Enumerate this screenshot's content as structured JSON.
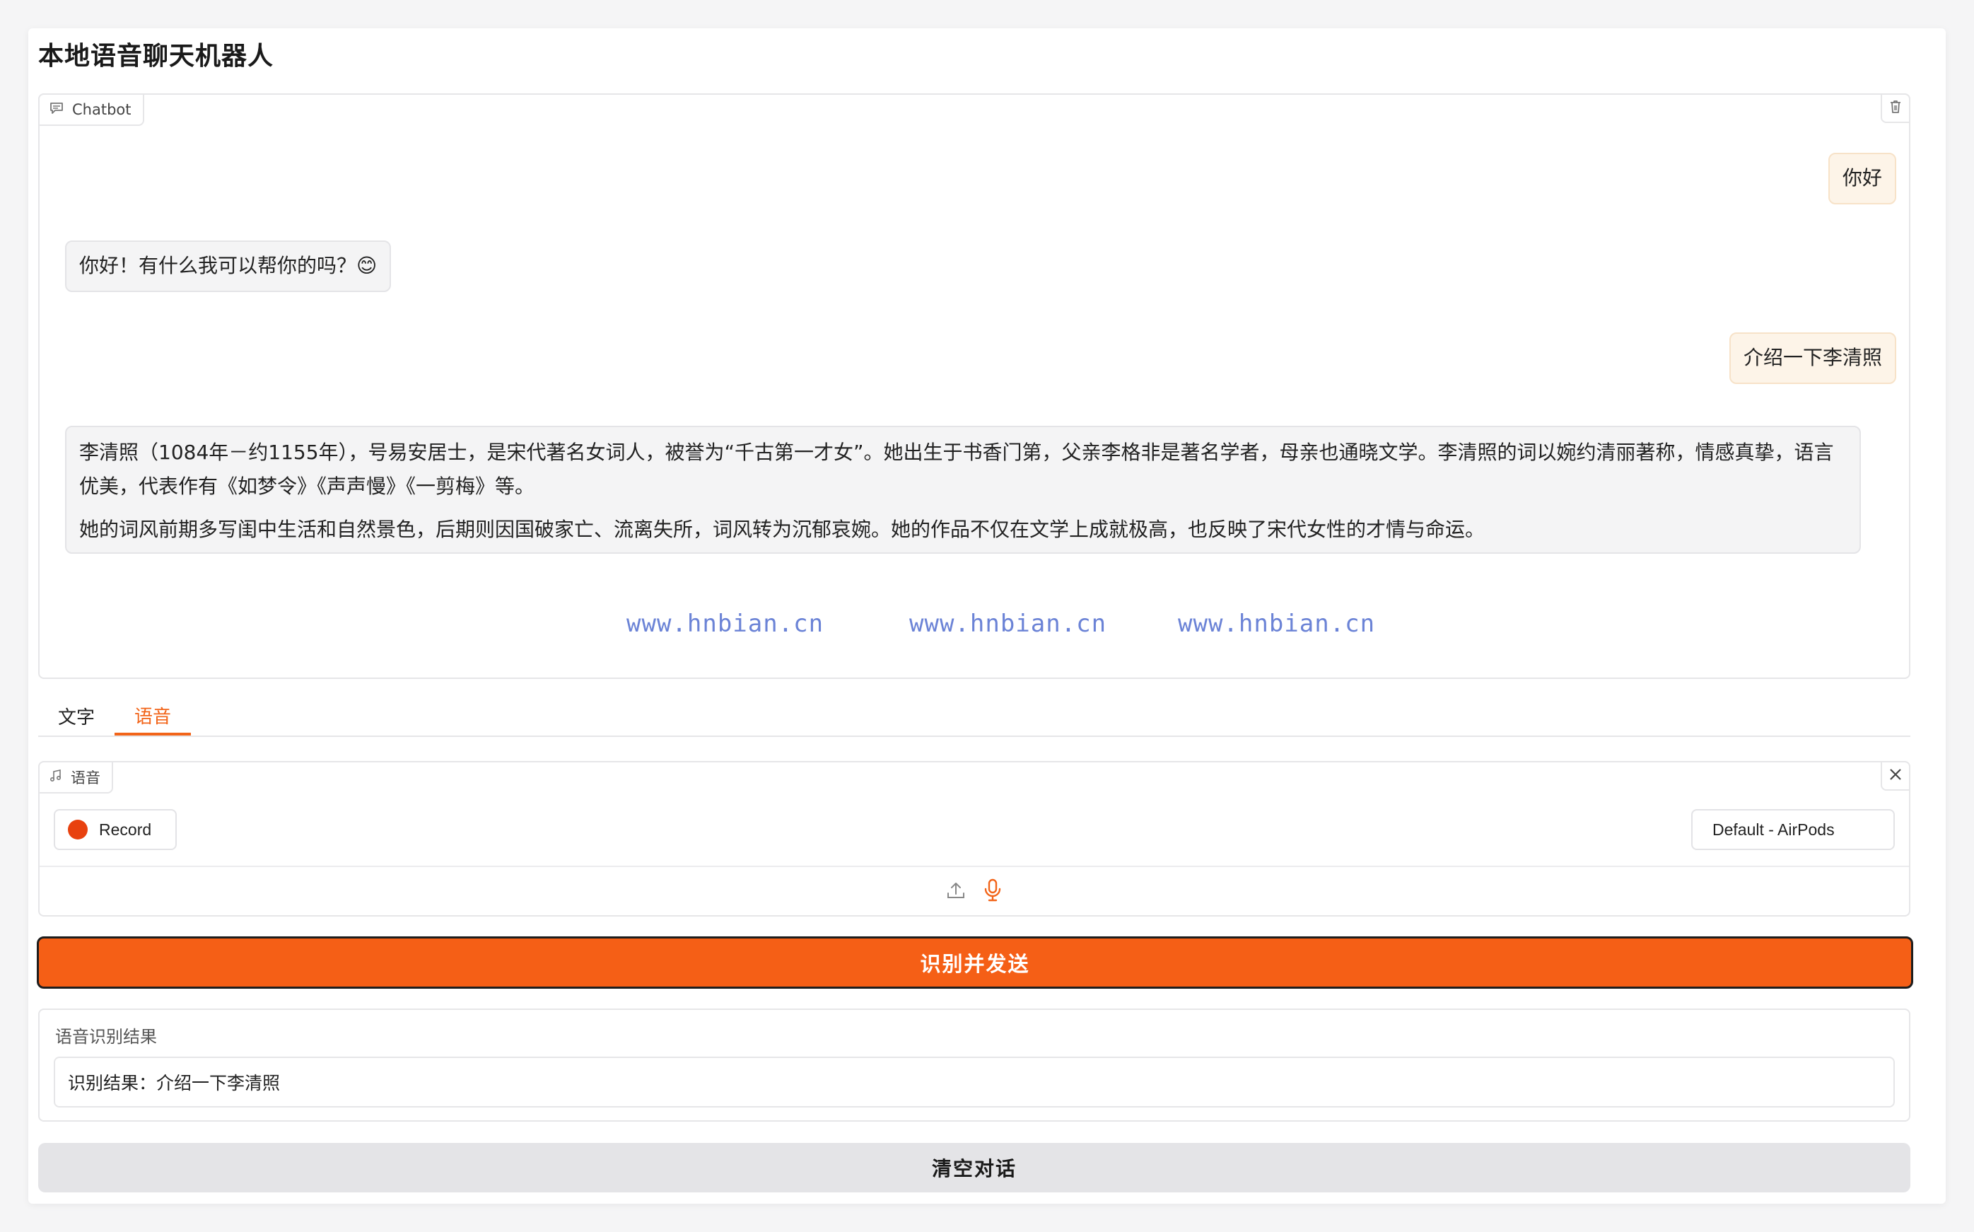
{
  "app": {
    "title": "本地语音聊天机器人"
  },
  "chatbot": {
    "label": "Chatbot",
    "messages": [
      {
        "role": "user",
        "text": "你好"
      },
      {
        "role": "bot",
        "text": "你好！有什么我可以帮你的吗？😊"
      },
      {
        "role": "user",
        "text": "介绍一下李清照"
      },
      {
        "role": "bot",
        "paragraphs": [
          "李清照（1084年－约1155年），号易安居士，是宋代著名女词人，被誉为“千古第一才女”。她出生于书香门第，父亲李格非是著名学者，母亲也通晓文学。李清照的词以婉约清丽著称，情感真挚，语言优美，代表作有《如梦令》《声声慢》《一剪梅》等。",
          "她的词风前期多写闺中生活和自然景色，后期则因国破家亡、流离失所，词风转为沉郁哀婉。她的作品不仅在文学上成就极高，也反映了宋代女性的才情与命运。"
        ]
      }
    ],
    "watermarks": [
      "www.hnbian.cn",
      "www.hnbian.cn",
      "www.hnbian.cn"
    ]
  },
  "tabs": [
    {
      "label": "文字",
      "active": false
    },
    {
      "label": "语音",
      "active": true
    }
  ],
  "audio": {
    "label": "语音",
    "record_label": "Record",
    "device": "Default - AirPods"
  },
  "send_button": "识别并发送",
  "result": {
    "label": "语音识别结果",
    "value": "识别结果：介绍一下李清照"
  },
  "clear_button": "清空对话",
  "colors": {
    "accent": "#f55f16",
    "record_dot": "#e8410f",
    "watermark": "#6b83d6"
  }
}
